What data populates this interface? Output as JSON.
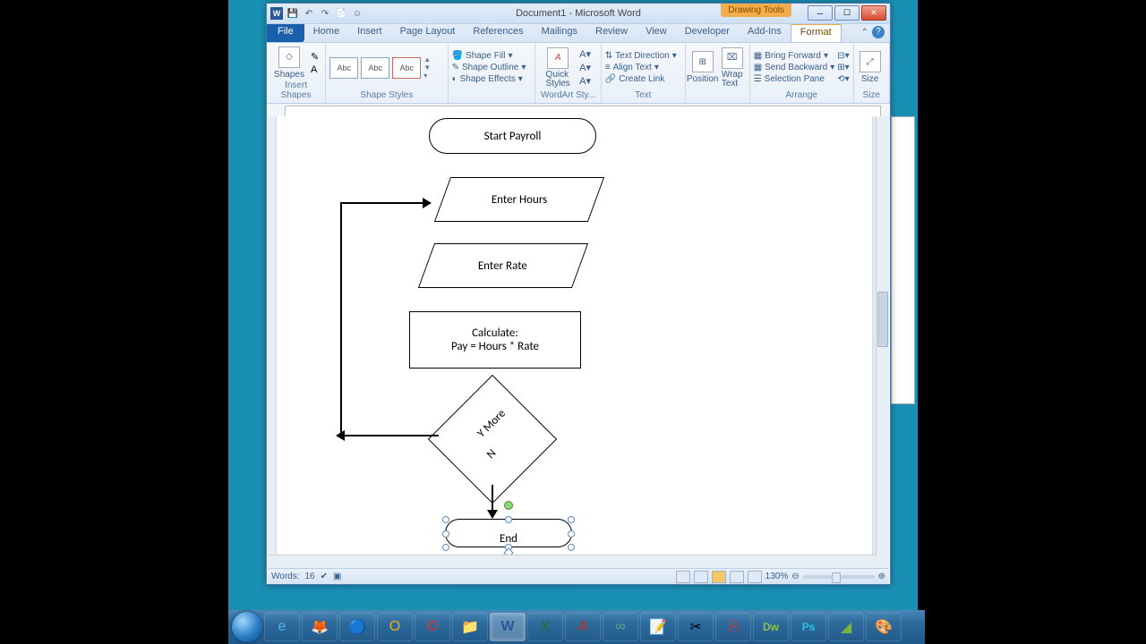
{
  "title": "Document1 - Microsoft Word",
  "context_tab": "Drawing Tools",
  "tabs": [
    "Home",
    "Insert",
    "Page Layout",
    "References",
    "Mailings",
    "Review",
    "View",
    "Developer",
    "Add-Ins",
    "Format"
  ],
  "file_tab": "File",
  "ribbon": {
    "insert_shapes": {
      "label": "Insert Shapes",
      "shapes": "Shapes"
    },
    "shape_styles": {
      "label": "Shape Styles",
      "fill": "Shape Fill",
      "outline": "Shape Outline",
      "effects": "Shape Effects",
      "abc": "Abc"
    },
    "wordart": {
      "label": "WordArt Sty...",
      "quick": "Quick\nStyles"
    },
    "text": {
      "label": "Text",
      "dir": "Text Direction",
      "align": "Align Text",
      "link": "Create Link"
    },
    "arrange": {
      "label": "Arrange",
      "position": "Position",
      "wrap": "Wrap\nText",
      "fwd": "Bring Forward",
      "back": "Send Backward",
      "pane": "Selection Pane"
    },
    "size": {
      "label": "Size",
      "size": "Size"
    }
  },
  "flowchart": {
    "start": "Start Payroll",
    "input1": "Enter Hours",
    "input2": "Enter Rate",
    "process_l1": "Calculate:",
    "process_l2": "Pay = Hours * Rate",
    "decision_l1": "Y   More",
    "decision_l2": "N",
    "end": "End"
  },
  "status": {
    "words_label": "Words:",
    "words": "16",
    "zoom": "130%"
  },
  "taskbar_icons": [
    "IE",
    "FF",
    "CH",
    "OL",
    "OP",
    "EX",
    "W",
    "X",
    "A",
    "∞",
    "N",
    "SC",
    "PDF",
    "Dw",
    "Ps",
    "P",
    "C"
  ]
}
